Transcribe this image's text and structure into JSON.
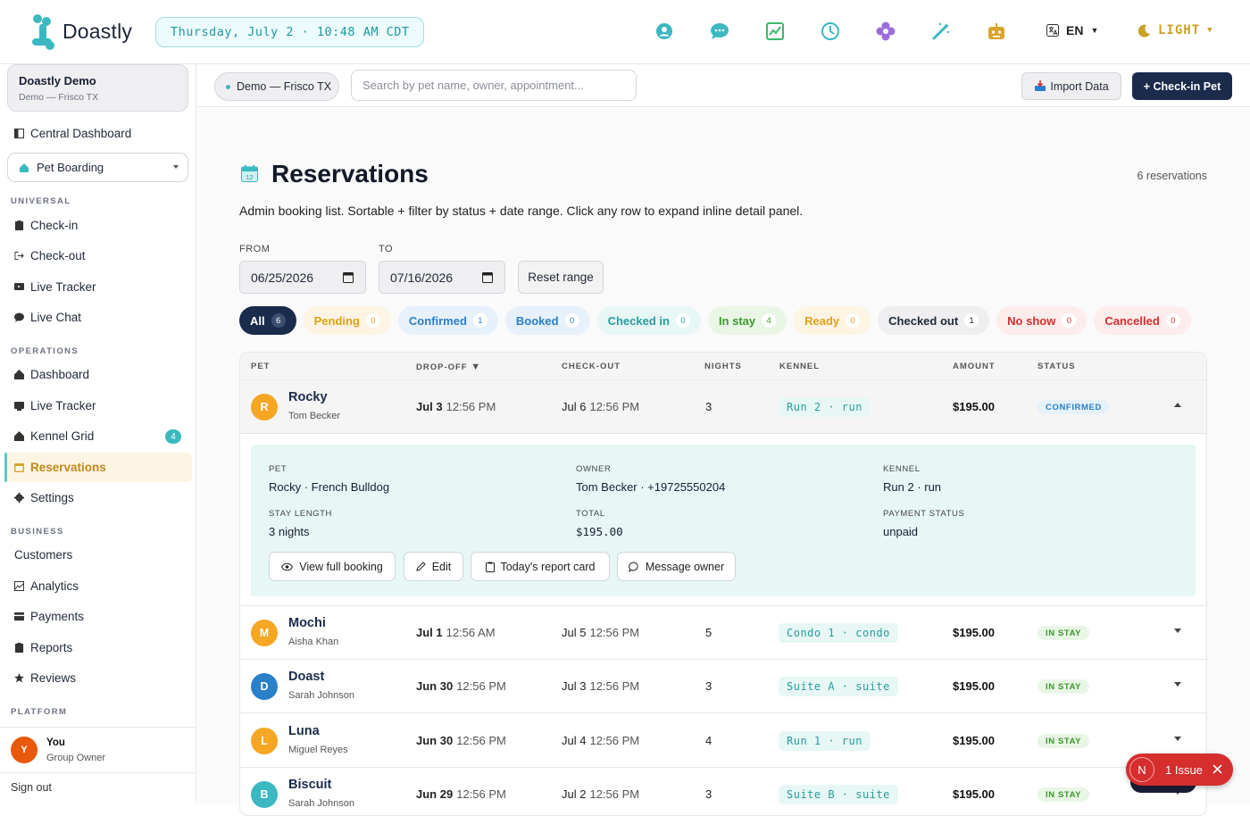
{
  "app": {
    "name": "Doastly",
    "datetime": "Thursday, July 2 · 10:48 AM CDT",
    "lang": "EN",
    "theme": "LIGHT"
  },
  "top_icons": [
    "users-circle-icon",
    "chat-icon",
    "chart-line-icon",
    "clock-icon",
    "flower-icon",
    "magic-wand-icon",
    "robot-icon"
  ],
  "sidebar": {
    "org": {
      "name": "Doastly Demo",
      "sub": "Demo — Frisco TX"
    },
    "central": "Central Dashboard",
    "module_select": "Pet Boarding",
    "sections": {
      "universal": "UNIVERSAL",
      "operations": "OPERATIONS",
      "business": "BUSINESS",
      "platform": "PLATFORM"
    },
    "universal_items": [
      "Check-in",
      "Check-out",
      "Live Tracker",
      "Live Chat"
    ],
    "operations_items": [
      "Dashboard",
      "Live Tracker",
      "Kennel Grid",
      "Reservations",
      "Settings"
    ],
    "kennel_badge": "4",
    "business_items": [
      "Customers",
      "Analytics",
      "Payments",
      "Reports",
      "Reviews"
    ],
    "user": {
      "initial": "Y",
      "name": "You",
      "role": "Group Owner"
    },
    "signout": "Sign out"
  },
  "toolbar": {
    "location": "Demo — Frisco TX",
    "search_placeholder": "Search by pet name, owner, appointment...",
    "import_label": "Import Data",
    "checkin_label": "+ Check-in Pet"
  },
  "page": {
    "title": "Reservations",
    "count": "6 reservations",
    "subtitle": "Admin booking list. Sortable + filter by status + date range. Click any row to expand inline detail panel.",
    "from_label": "FROM",
    "to_label": "TO",
    "from_value": "06/25/2026",
    "to_value": "07/16/2026",
    "reset_label": "Reset range"
  },
  "filters": [
    {
      "label": "All",
      "count": "6",
      "bg": "#1a2b4c",
      "fg": "#ffffff",
      "cntbg": "#3d4f70",
      "cntfg": "#ffffff"
    },
    {
      "label": "Pending",
      "count": "0",
      "bg": "#fdf4e3",
      "fg": "#e0a11b"
    },
    {
      "label": "Confirmed",
      "count": "1",
      "bg": "#e6f1fb",
      "fg": "#2a7fc9"
    },
    {
      "label": "Booked",
      "count": "0",
      "bg": "#e6f1fb",
      "fg": "#2a7fc9"
    },
    {
      "label": "Checked in",
      "count": "0",
      "bg": "#e7f7f5",
      "fg": "#2a9ca0"
    },
    {
      "label": "In stay",
      "count": "4",
      "bg": "#e9f6e6",
      "fg": "#3c9a2b"
    },
    {
      "label": "Ready",
      "count": "0",
      "bg": "#fdf4e3",
      "fg": "#e0a11b"
    },
    {
      "label": "Checked out",
      "count": "1",
      "bg": "#efeff1",
      "fg": "#1f2937"
    },
    {
      "label": "No show",
      "count": "0",
      "bg": "#fdecec",
      "fg": "#d62d2d"
    },
    {
      "label": "Cancelled",
      "count": "0",
      "bg": "#fdecec",
      "fg": "#d62d2d"
    }
  ],
  "table": {
    "headers": {
      "pet": "PET",
      "dropoff": "DROP-OFF",
      "checkout": "CHECK-OUT",
      "nights": "NIGHTS",
      "kennel": "KENNEL",
      "amount": "AMOUNT",
      "status": "STATUS"
    },
    "sort_indicator": "▼",
    "rows": [
      {
        "initial": "R",
        "avatar": "#f5a623",
        "pet": "Rocky",
        "owner": "Tom Becker",
        "drop_date": "Jul 3",
        "drop_time": "12:56 PM",
        "out_date": "Jul 6",
        "out_time": "12:56 PM",
        "nights": "3",
        "kennel": "Run 2 · run",
        "amount": "$195.00",
        "status": "CONFIRMED",
        "status_bg": "#e6f1fb",
        "status_fg": "#2a7fc9"
      },
      {
        "initial": "M",
        "avatar": "#f5a623",
        "pet": "Mochi",
        "owner": "Aisha Khan",
        "drop_date": "Jul 1",
        "drop_time": "12:56 AM",
        "out_date": "Jul 5",
        "out_time": "12:56 PM",
        "nights": "5",
        "kennel": "Condo 1 · condo",
        "amount": "$195.00",
        "status": "IN STAY",
        "status_bg": "#e9f6e6",
        "status_fg": "#3c9a2b"
      },
      {
        "initial": "D",
        "avatar": "#2a7fc9",
        "pet": "Doast",
        "owner": "Sarah Johnson",
        "drop_date": "Jun 30",
        "drop_time": "12:56 PM",
        "out_date": "Jul 3",
        "out_time": "12:56 PM",
        "nights": "3",
        "kennel": "Suite A · suite",
        "amount": "$195.00",
        "status": "IN STAY",
        "status_bg": "#e9f6e6",
        "status_fg": "#3c9a2b"
      },
      {
        "initial": "L",
        "avatar": "#f5a623",
        "pet": "Luna",
        "owner": "Miguel Reyes",
        "drop_date": "Jun 30",
        "drop_time": "12:56 PM",
        "out_date": "Jul 4",
        "out_time": "12:56 PM",
        "nights": "4",
        "kennel": "Run 1 · run",
        "amount": "$195.00",
        "status": "IN STAY",
        "status_bg": "#e9f6e6",
        "status_fg": "#3c9a2b"
      },
      {
        "initial": "B",
        "avatar": "#3cb8c1",
        "pet": "Biscuit",
        "owner": "Sarah Johnson",
        "drop_date": "Jun 29",
        "drop_time": "12:56 PM",
        "out_date": "Jul 2",
        "out_time": "12:56 PM",
        "nights": "3",
        "kennel": "Suite B · suite",
        "amount": "$195.00",
        "status": "IN STAY",
        "status_bg": "#e9f6e6",
        "status_fg": "#3c9a2b"
      }
    ]
  },
  "detail": {
    "pet_label": "PET",
    "pet_value": "Rocky · French Bulldog",
    "owner_label": "OWNER",
    "owner_value": "Tom Becker · +19725550204",
    "kennel_label": "KENNEL",
    "kennel_value": "Run 2 · run",
    "stay_label": "STAY LENGTH",
    "stay_value": "3 nights",
    "total_label": "TOTAL",
    "total_value": "$195.00",
    "payment_label": "PAYMENT STATUS",
    "payment_value": "unpaid",
    "buttons": {
      "view": "View full booking",
      "edit": "Edit",
      "report": "Today's report card",
      "message": "Message owner"
    }
  },
  "issues": {
    "initial": "N",
    "label": "1 Issue"
  }
}
